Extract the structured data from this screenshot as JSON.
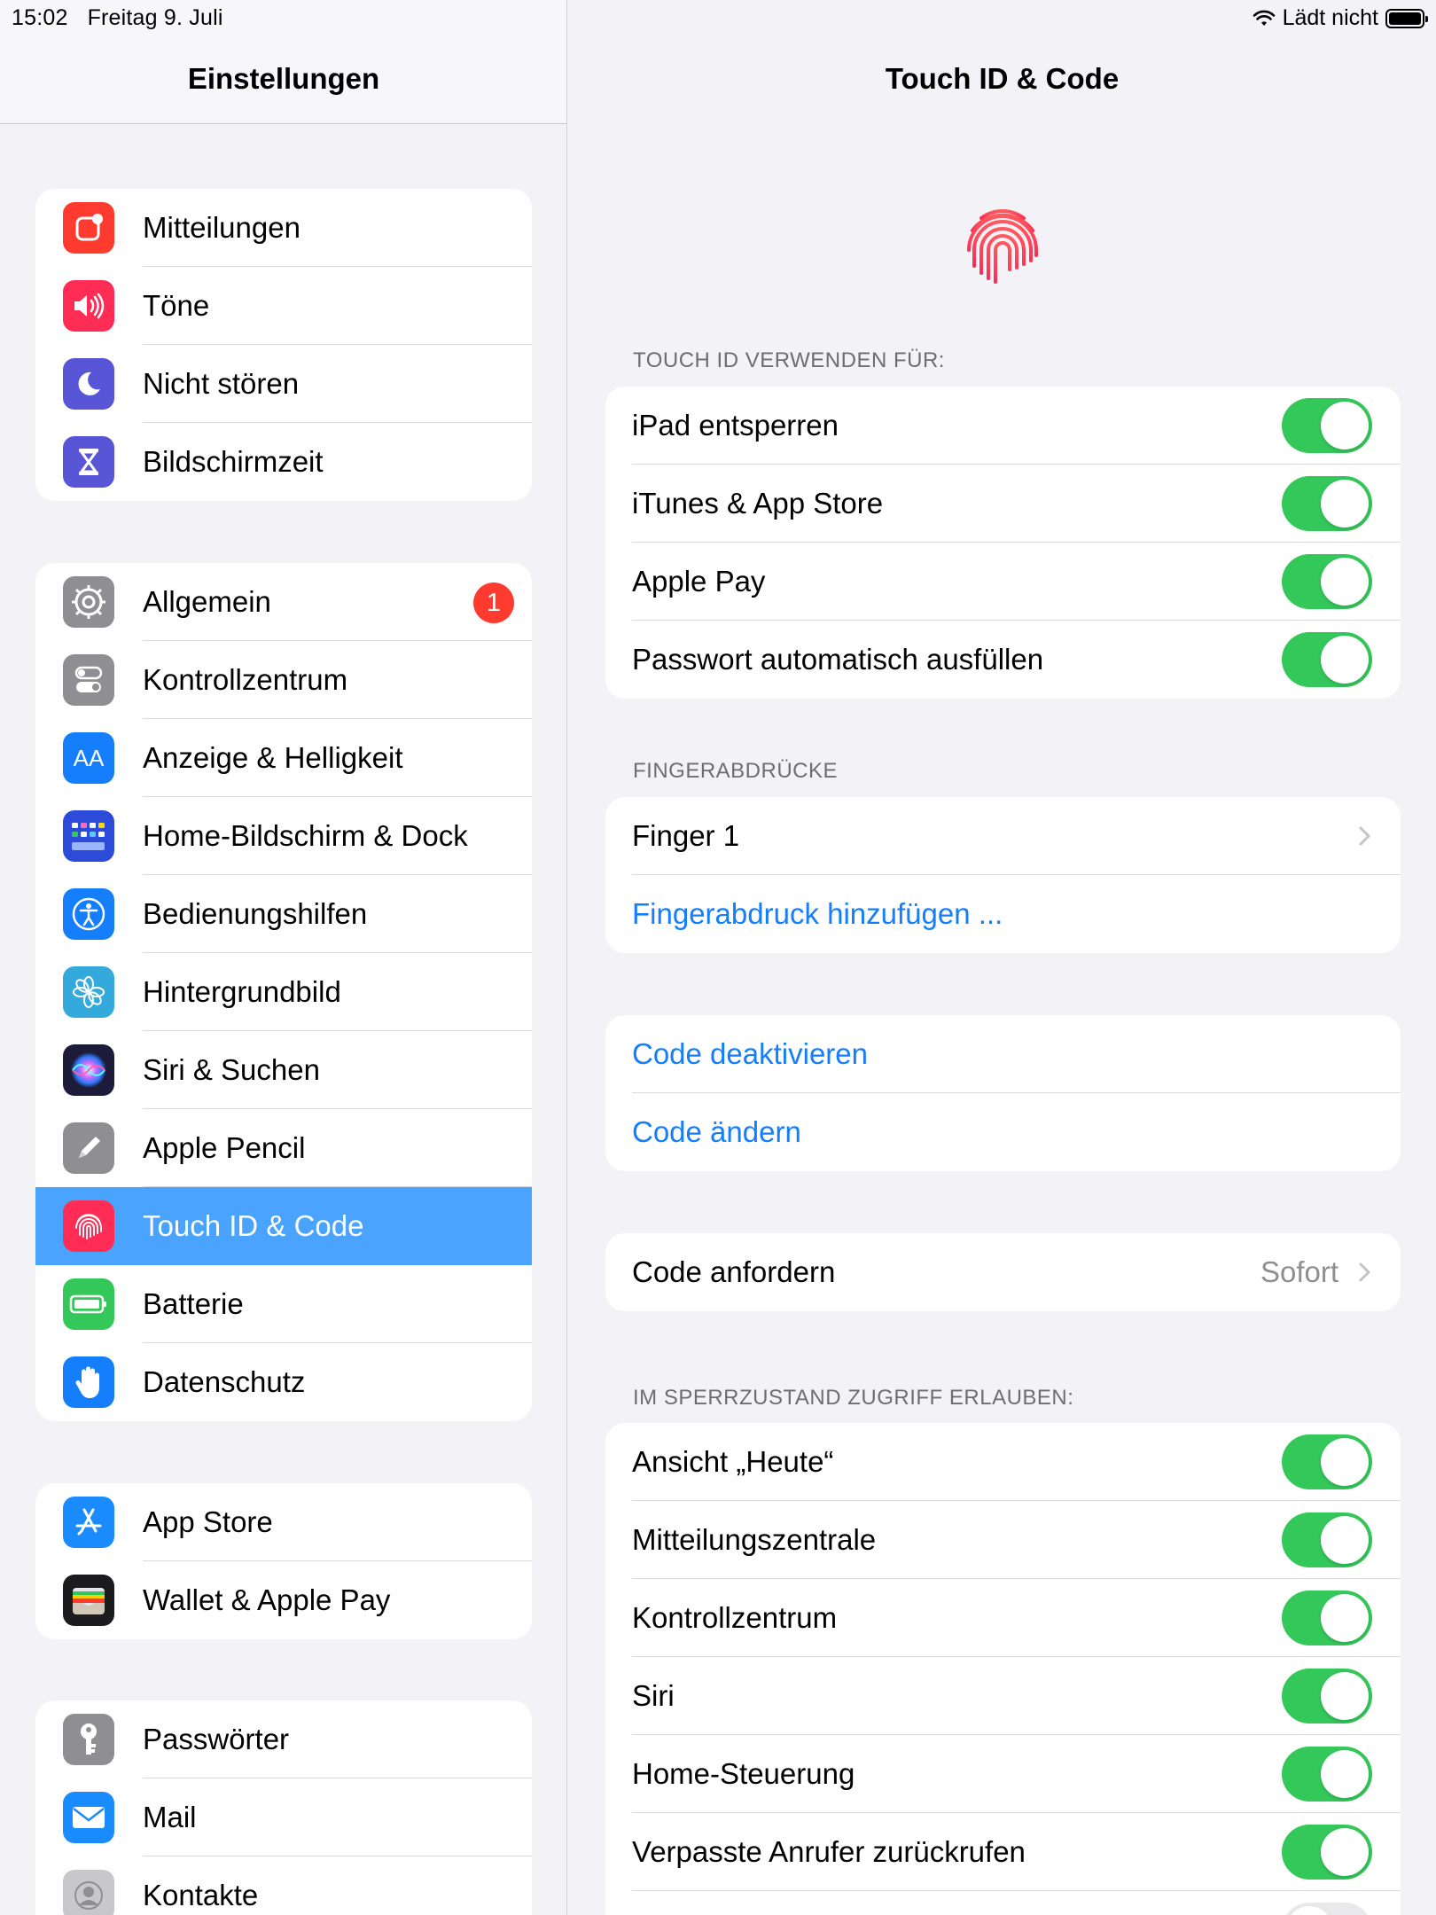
{
  "status_bar": {
    "time": "15:02",
    "date": "Freitag 9. Juli",
    "charging": "Lädt nicht"
  },
  "sidebar": {
    "title": "Einstellungen",
    "groups": [
      {
        "items": [
          {
            "label": "Mitteilungen",
            "icon": "notifications-icon",
            "color": "#ff3b30"
          },
          {
            "label": "Töne",
            "icon": "sounds-icon",
            "color": "#ff2d55"
          },
          {
            "label": "Nicht stören",
            "icon": "moon-icon",
            "color": "#5856d6"
          },
          {
            "label": "Bildschirmzeit",
            "icon": "hourglass-icon",
            "color": "#5856d6"
          }
        ]
      },
      {
        "items": [
          {
            "label": "Allgemein",
            "icon": "gear-icon",
            "color": "#8e8e93",
            "badge": "1"
          },
          {
            "label": "Kontrollzentrum",
            "icon": "control-center-icon",
            "color": "#8e8e93"
          },
          {
            "label": "Anzeige & Helligkeit",
            "icon": "display-icon",
            "color": "#147efb",
            "glyph": "AA"
          },
          {
            "label": "Home-Bildschirm & Dock",
            "icon": "home-screen-icon",
            "color": "#2c4bd8"
          },
          {
            "label": "Bedienungshilfen",
            "icon": "accessibility-icon",
            "color": "#147efb"
          },
          {
            "label": "Hintergrundbild",
            "icon": "wallpaper-icon",
            "color": "#34aadc"
          },
          {
            "label": "Siri & Suchen",
            "icon": "siri-icon",
            "color": "#1c1c3a"
          },
          {
            "label": "Apple Pencil",
            "icon": "pencil-icon",
            "color": "#8e8e93"
          },
          {
            "label": "Touch ID & Code",
            "icon": "fingerprint-icon",
            "color": "#ff2d55",
            "selected": true
          },
          {
            "label": "Batterie",
            "icon": "battery-icon",
            "color": "#34c759"
          },
          {
            "label": "Datenschutz",
            "icon": "hand-icon",
            "color": "#147efb"
          }
        ]
      },
      {
        "items": [
          {
            "label": "App Store",
            "icon": "app-store-icon",
            "color": "#1a8cff"
          },
          {
            "label": "Wallet & Apple Pay",
            "icon": "wallet-icon",
            "color": "#1c1c1e"
          }
        ]
      },
      {
        "items": [
          {
            "label": "Passwörter",
            "icon": "key-icon",
            "color": "#8e8e93"
          },
          {
            "label": "Mail",
            "icon": "mail-icon",
            "color": "#1a8cff"
          },
          {
            "label": "Kontakte",
            "icon": "contacts-icon",
            "color": "#c7c7cc"
          }
        ]
      }
    ]
  },
  "detail": {
    "title": "Touch ID & Code",
    "touch_id_header": "TOUCH ID VERWENDEN FÜR:",
    "touch_id_items": [
      {
        "label": "iPad entsperren",
        "on": true
      },
      {
        "label": "iTunes & App Store",
        "on": true
      },
      {
        "label": "Apple Pay",
        "on": true
      },
      {
        "label": "Passwort automatisch ausfüllen",
        "on": true
      }
    ],
    "fingerprints_header": "FINGERABDRÜCKE",
    "finger1": "Finger 1",
    "add_fingerprint": "Fingerabdruck hinzufügen ...",
    "code_off": "Code deaktivieren",
    "code_change": "Code ändern",
    "require_code": "Code anfordern",
    "require_code_value": "Sofort",
    "lock_header": "IM SPERRZUSTAND ZUGRIFF ERLAUBEN:",
    "lock_items": [
      {
        "label": "Ansicht „Heute“",
        "on": true
      },
      {
        "label": "Mitteilungszentrale",
        "on": true
      },
      {
        "label": "Kontrollzentrum",
        "on": true
      },
      {
        "label": "Siri",
        "on": true
      },
      {
        "label": "Home-Steuerung",
        "on": true
      },
      {
        "label": "Verpasste Anrufer zurückrufen",
        "on": true
      }
    ]
  }
}
